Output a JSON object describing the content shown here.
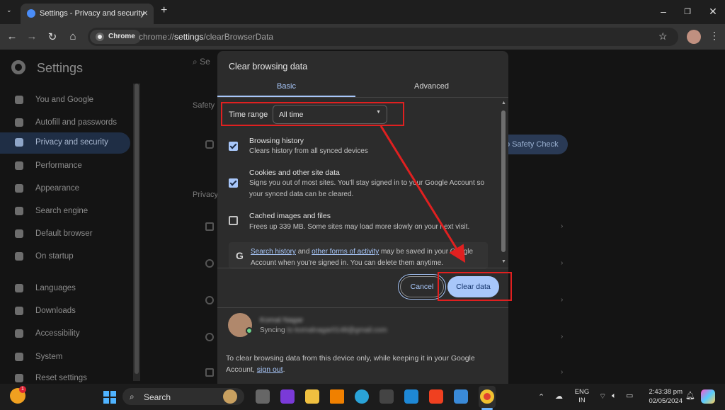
{
  "browser": {
    "tab_title": "Settings - Privacy and security",
    "omnibox_chip": "Chrome",
    "url_prefix": "chrome://",
    "url_host": "settings",
    "url_path": "/clearBrowserData"
  },
  "settings": {
    "title": "Settings",
    "search_partial": "Se",
    "nav_items": [
      {
        "label": "You and Google",
        "icon": "person-icon"
      },
      {
        "label": "Autofill and passwords",
        "icon": "autofill-icon"
      },
      {
        "label": "Privacy and security",
        "icon": "shield-icon",
        "active": true
      },
      {
        "label": "Performance",
        "icon": "speedometer-icon"
      },
      {
        "label": "Appearance",
        "icon": "palette-icon"
      },
      {
        "label": "Search engine",
        "icon": "search-icon"
      },
      {
        "label": "Default browser",
        "icon": "browser-icon"
      },
      {
        "label": "On startup",
        "icon": "power-icon"
      },
      {
        "label": "Languages",
        "icon": "globe-icon"
      },
      {
        "label": "Downloads",
        "icon": "download-icon"
      },
      {
        "label": "Accessibility",
        "icon": "accessibility-icon"
      },
      {
        "label": "System",
        "icon": "wrench-icon"
      },
      {
        "label": "Reset settings",
        "icon": "reset-icon"
      }
    ],
    "section_safety": "Safety",
    "section_privacy": "Privacy",
    "safety_button": "o Safety Check"
  },
  "dialog": {
    "title": "Clear browsing data",
    "tabs": [
      "Basic",
      "Advanced"
    ],
    "time_range_label": "Time range",
    "time_range_value": "All time",
    "options": [
      {
        "title": "Browsing history",
        "desc": "Clears history from all synced devices",
        "checked": true
      },
      {
        "title": "Cookies and other site data",
        "desc": "Signs you out of most sites. You'll stay signed in to your Google Account so your synced data can be cleared.",
        "checked": true
      },
      {
        "title": "Cached images and files",
        "desc": "Frees up 339 MB. Some sites may load more slowly on your next visit.",
        "checked": false
      }
    ],
    "google_info": {
      "link1": "Search history",
      "mid1": " and ",
      "link2": "other forms of activity",
      "rest": " may be saved in your Google Account when you're signed in. You can delete them anytime."
    },
    "cancel_label": "Cancel",
    "clear_label": "Clear data",
    "account": {
      "name": "Komal Nagar",
      "sync_prefix": "Syncing",
      "sync_email": "to komalnagar0148@gmail.com"
    },
    "footer_text": "To clear browsing data from this device only, while keeping it in your Google Account, ",
    "footer_link": "sign out",
    "footer_end": "."
  },
  "taskbar": {
    "search_label": "Search",
    "lang_line1": "ENG",
    "lang_line2": "IN",
    "time": "2:43:38 pm",
    "date": "02/05/2024",
    "weather_badge": "1"
  },
  "colors": {
    "accent": "#a8c7fa",
    "highlight": "#e02020"
  }
}
